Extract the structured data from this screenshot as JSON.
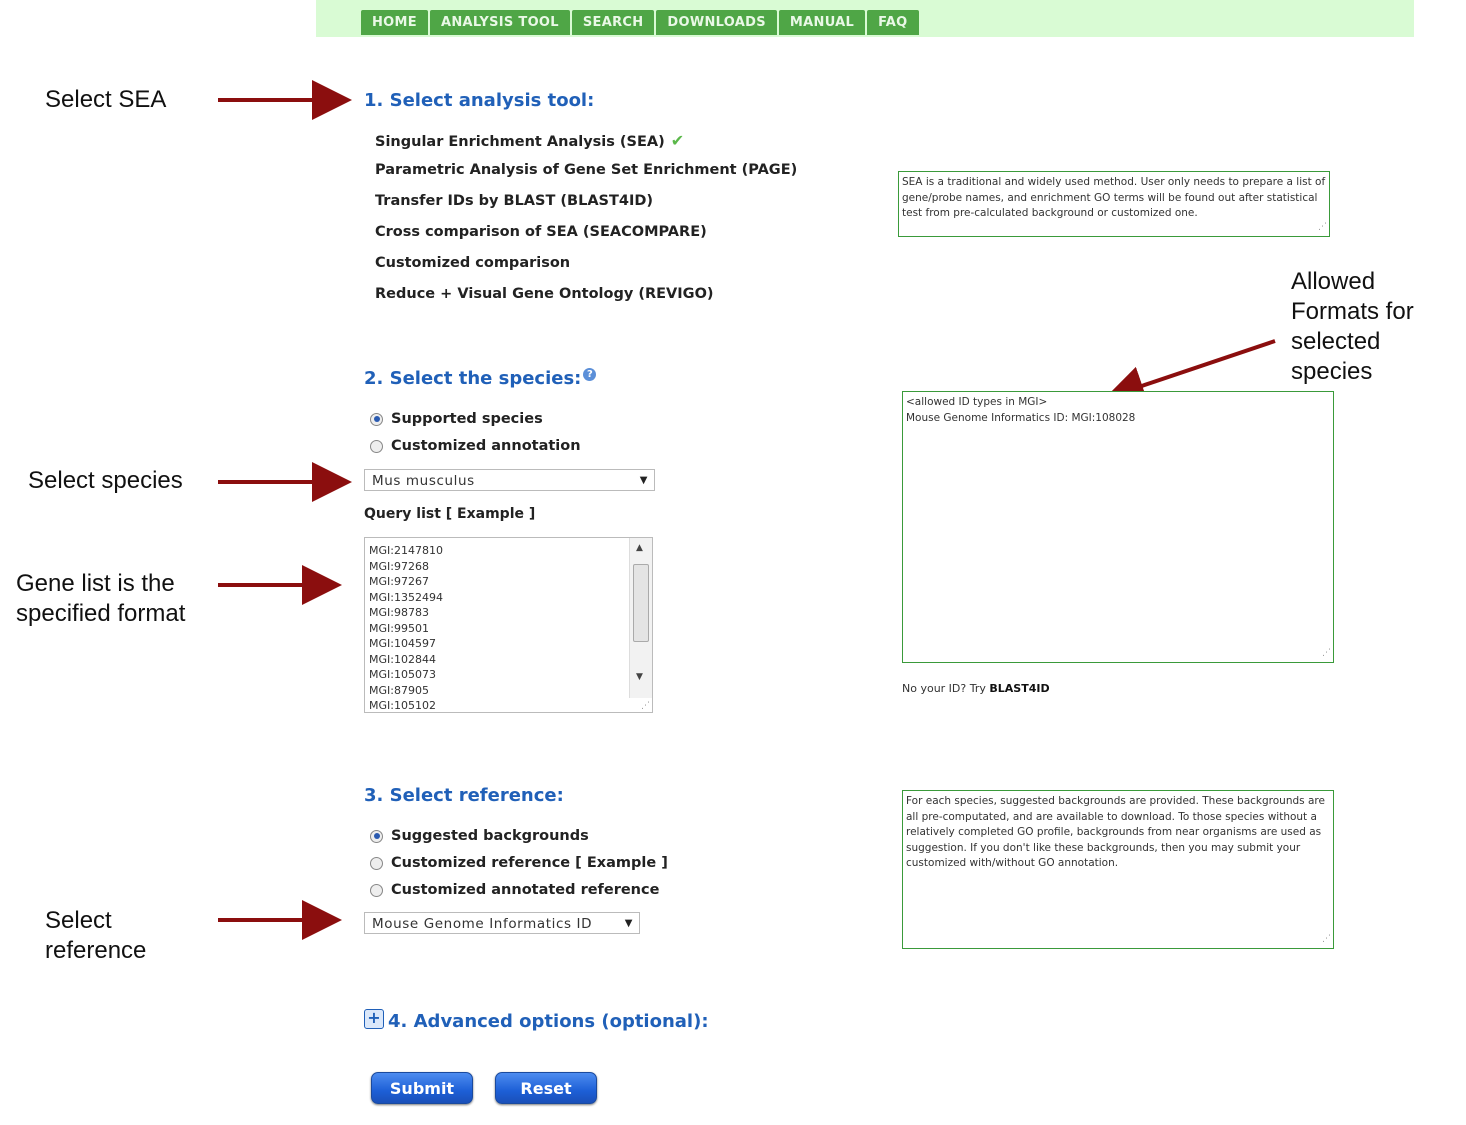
{
  "nav": {
    "items": [
      "HOME",
      "ANALYSIS TOOL",
      "SEARCH",
      "DOWNLOADS",
      "MANUAL",
      "FAQ"
    ]
  },
  "annotations": {
    "select_sea": "Select SEA",
    "allowed_formats": [
      "Allowed",
      "Formats for",
      "selected",
      "species"
    ],
    "select_species": "Select species",
    "gene_list": [
      "Gene list is the",
      "specified format"
    ],
    "select_reference": [
      "Select",
      "reference"
    ]
  },
  "section1": {
    "heading": "1. Select analysis tool:",
    "tools": [
      "Singular Enrichment Analysis (SEA)",
      "Parametric Analysis of Gene Set Enrichment (PAGE)",
      "Transfer IDs by BLAST (BLAST4ID)",
      "Cross comparison of SEA (SEACOMPARE)",
      "Customized comparison",
      "Reduce + Visual Gene Ontology (REVIGO)"
    ],
    "check_icon": "checkmark-icon",
    "description": "SEA is a traditional and widely used method. User only needs to prepare a list of gene/probe names, and enrichment GO terms will be found out after statistical test from pre-calculated background or customized one."
  },
  "section2": {
    "heading": "2. Select the species:",
    "help_icon": "help-icon",
    "radios": [
      "Supported species",
      "Customized annotation"
    ],
    "selected_radio": 0,
    "species_value": "Mus musculus",
    "query_label": "Query list [ Example ]",
    "query_lines": [
      "MGI:2147810",
      "MGI:97268",
      "MGI:97267",
      "MGI:1352494",
      "MGI:98783",
      "MGI:99501",
      "MGI:104597",
      "MGI:102844",
      "MGI:105073",
      "MGI:87905",
      "MGI:105102"
    ],
    "allowed_text_1": "<allowed ID types in MGI>",
    "allowed_text_2": "Mouse Genome Informatics ID:  MGI:108028",
    "hint_prefix": "No your ID? Try ",
    "hint_link": "BLAST4ID"
  },
  "section3": {
    "heading": "3. Select reference:",
    "radios": [
      "Suggested backgrounds",
      "Customized reference [ Example ]",
      "Customized annotated reference"
    ],
    "selected_radio": 0,
    "reference_value": "Mouse Genome Informatics ID",
    "description": "For each species, suggested backgrounds are provided. These backgrounds are all pre-computated, and are available to download. To those species without a relatively completed GO profile, backgrounds from near organisms are used as suggestion. If you don't like these backgrounds, then you may submit your customized with/without GO annotation."
  },
  "section4": {
    "heading": "4. Advanced options (optional):",
    "expand_icon": "plus-icon"
  },
  "buttons": {
    "submit": "Submit",
    "reset": "Reset"
  },
  "colors": {
    "nav_bg": "#4fa646",
    "topbar": "#d9fbd4",
    "heading": "#2060b8",
    "arrow": "#8b0e0e",
    "box_border": "#3a9a3a"
  }
}
